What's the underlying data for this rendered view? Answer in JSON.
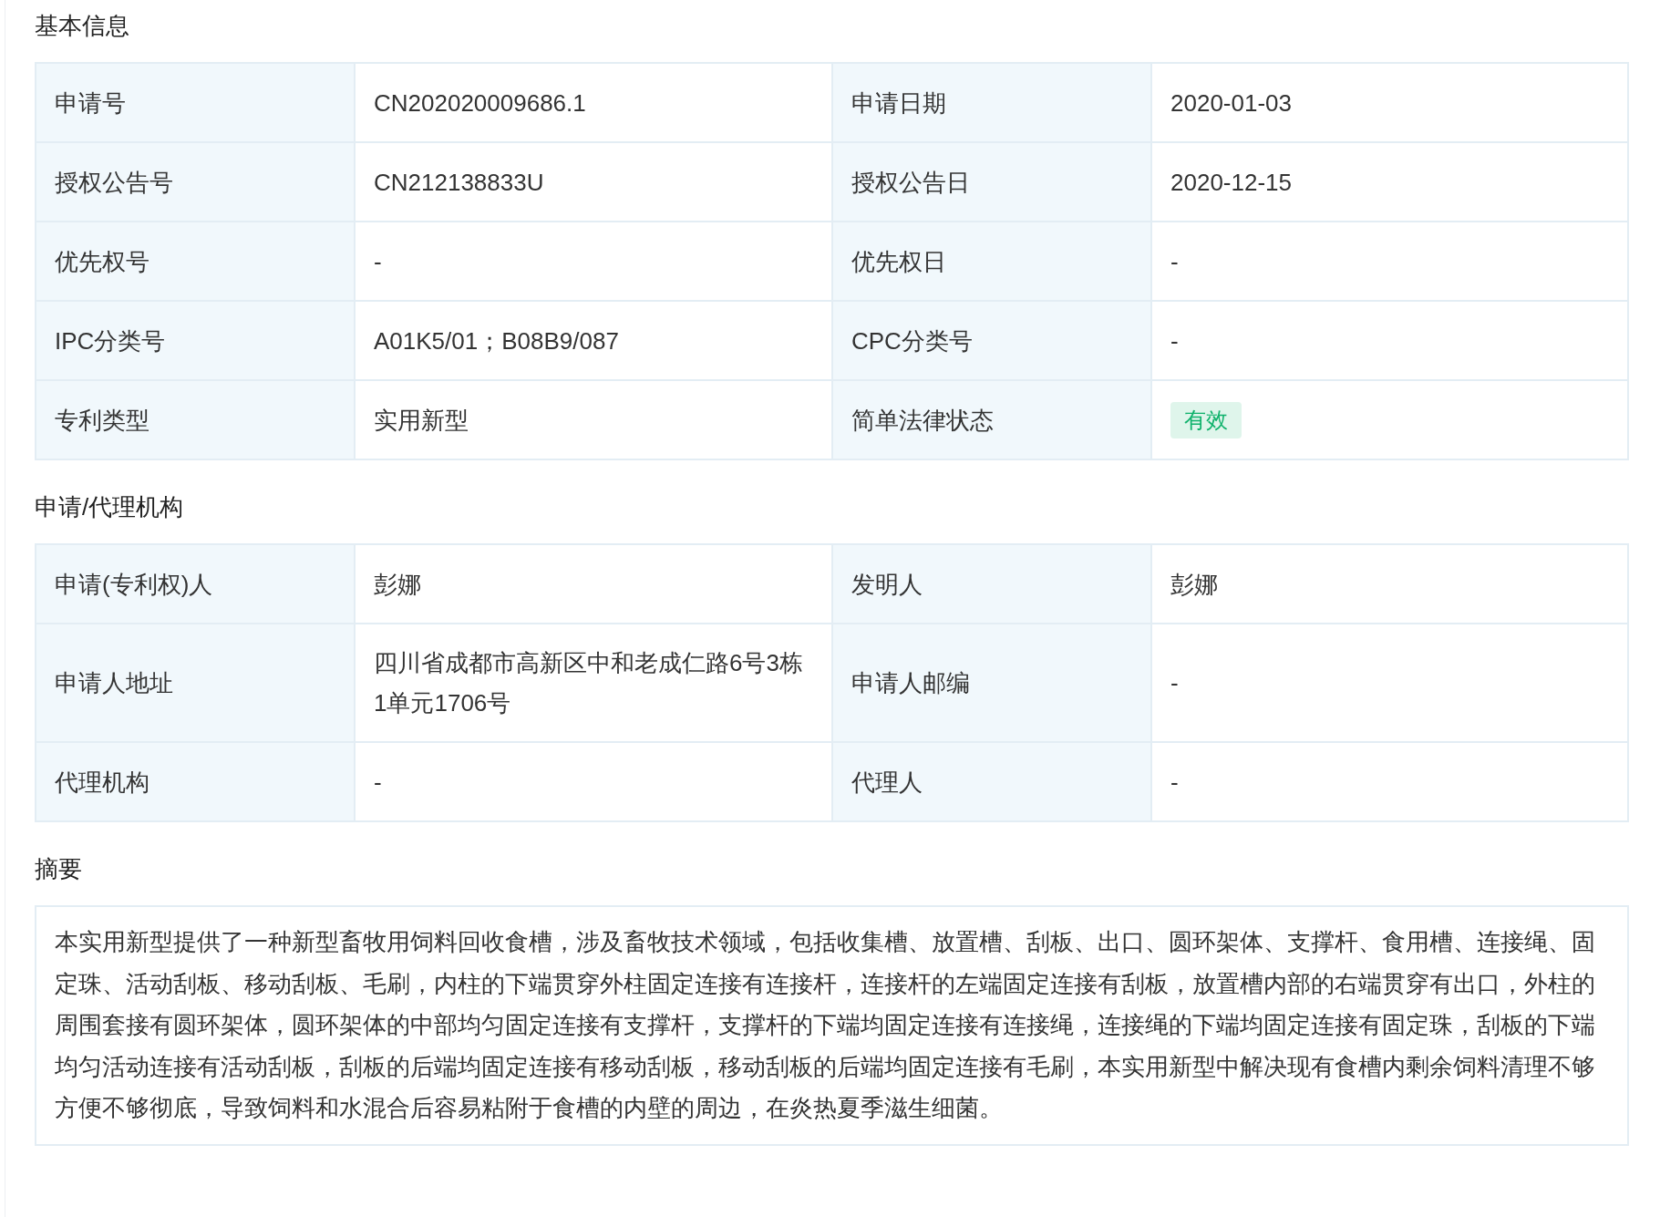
{
  "sections": [
    {
      "kind": "table",
      "title": "基本信息",
      "rows": [
        [
          {
            "label": "申请号",
            "value": "CN202020009686.1"
          },
          {
            "label": "申请日期",
            "value": "2020-01-03"
          }
        ],
        [
          {
            "label": "授权公告号",
            "value": "CN212138833U"
          },
          {
            "label": "授权公告日",
            "value": "2020-12-15"
          }
        ],
        [
          {
            "label": "优先权号",
            "value": "-"
          },
          {
            "label": "优先权日",
            "value": "-"
          }
        ],
        [
          {
            "label": "IPC分类号",
            "value": "A01K5/01；B08B9/087"
          },
          {
            "label": "CPC分类号",
            "value": "-"
          }
        ],
        [
          {
            "label": "专利类型",
            "value": "实用新型"
          },
          {
            "label": "简单法律状态",
            "value": "有效",
            "kind": "badge",
            "color": "#10b26c"
          }
        ]
      ]
    },
    {
      "kind": "table",
      "title": "申请/代理机构",
      "rows": [
        [
          {
            "label": "申请(专利权)人",
            "value": "彭娜"
          },
          {
            "label": "发明人",
            "value": "彭娜"
          }
        ],
        [
          {
            "label": "申请人地址",
            "value": "四川省成都市高新区中和老成仁路6号3栋1单元1706号"
          },
          {
            "label": "申请人邮编",
            "value": "-"
          }
        ],
        [
          {
            "label": "代理机构",
            "value": "-"
          },
          {
            "label": "代理人",
            "value": "-"
          }
        ]
      ]
    },
    {
      "kind": "text",
      "title": "摘要",
      "text": "本实用新型提供了一种新型畜牧用饲料回收食槽，涉及畜牧技术领域，包括收集槽、放置槽、刮板、出口、圆环架体、支撑杆、食用槽、连接绳、固定珠、活动刮板、移动刮板、毛刷，内柱的下端贯穿外柱固定连接有连接杆，连接杆的左端固定连接有刮板，放置槽内部的右端贯穿有出口，外柱的周围套接有圆环架体，圆环架体的中部均匀固定连接有支撑杆，支撑杆的下端均固定连接有连接绳，连接绳的下端均固定连接有固定珠，刮板的下端均匀活动连接有活动刮板，刮板的后端均固定连接有移动刮板，移动刮板的后端均固定连接有毛刷，本实用新型中解决现有食槽内剩余饲料清理不够方便不够彻底，导致饲料和水混合后容易粘附于食槽的内壁的周边，在炎热夏季滋生细菌。"
    }
  ]
}
